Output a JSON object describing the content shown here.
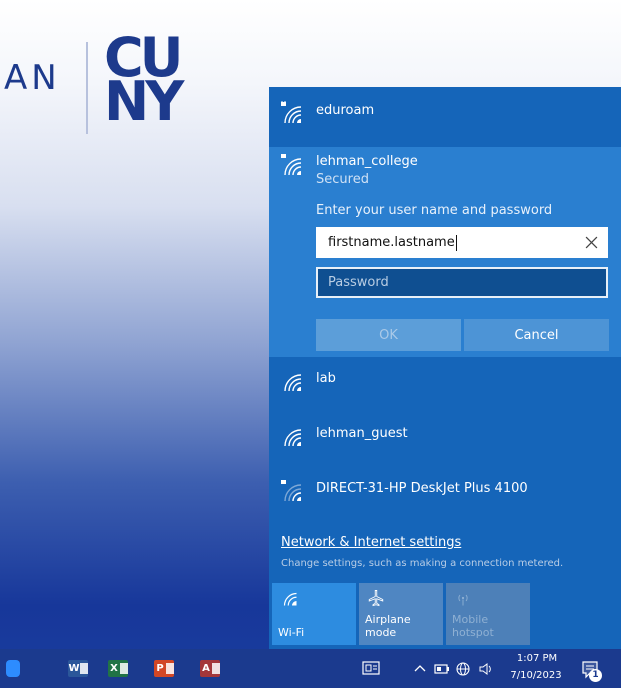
{
  "wallpaper": {
    "brand_text": "AN",
    "logo_line1": "CU",
    "logo_line2": "NY"
  },
  "flyout": {
    "networks": [
      {
        "name": "eduroam",
        "secured": true
      },
      {
        "name": "lehman_college",
        "status": "Secured",
        "secured": true,
        "expanded": true
      },
      {
        "name": "lab",
        "secured": false
      },
      {
        "name": "lehman_guest",
        "secured": false
      },
      {
        "name": "DIRECT-31-HP DeskJet Plus 4100",
        "secured": true
      }
    ],
    "credentials": {
      "prompt": "Enter your user name and password",
      "username_value": "firstname.lastname",
      "password_placeholder": "Password",
      "ok_label": "OK",
      "cancel_label": "Cancel"
    },
    "settings_link": "Network & Internet settings",
    "settings_desc": "Change settings, such as making a connection metered.",
    "quick_actions": [
      {
        "label": "Wi-Fi",
        "icon": "wifi-icon",
        "active": true
      },
      {
        "label": "Airplane mode",
        "icon": "airplane-icon",
        "active": false
      },
      {
        "label": "Mobile\nhotspot",
        "icon": "hotspot-icon",
        "active": false,
        "disabled": true
      }
    ]
  },
  "taskbar": {
    "apps": [
      {
        "name": "zoom",
        "glyph": ""
      },
      {
        "name": "word",
        "glyph": "W"
      },
      {
        "name": "excel",
        "glyph": "X"
      },
      {
        "name": "powerpoint",
        "glyph": "P"
      },
      {
        "name": "access",
        "glyph": "A"
      }
    ],
    "time": "1:07 PM",
    "date": "7/10/2023",
    "notification_count": "1"
  },
  "colors": {
    "flyout_bg": "#1565b9",
    "expanded_bg": "#2a7fd0",
    "taskbar_bg": "#1b3a8e",
    "brand_blue": "#1d3a8c"
  }
}
